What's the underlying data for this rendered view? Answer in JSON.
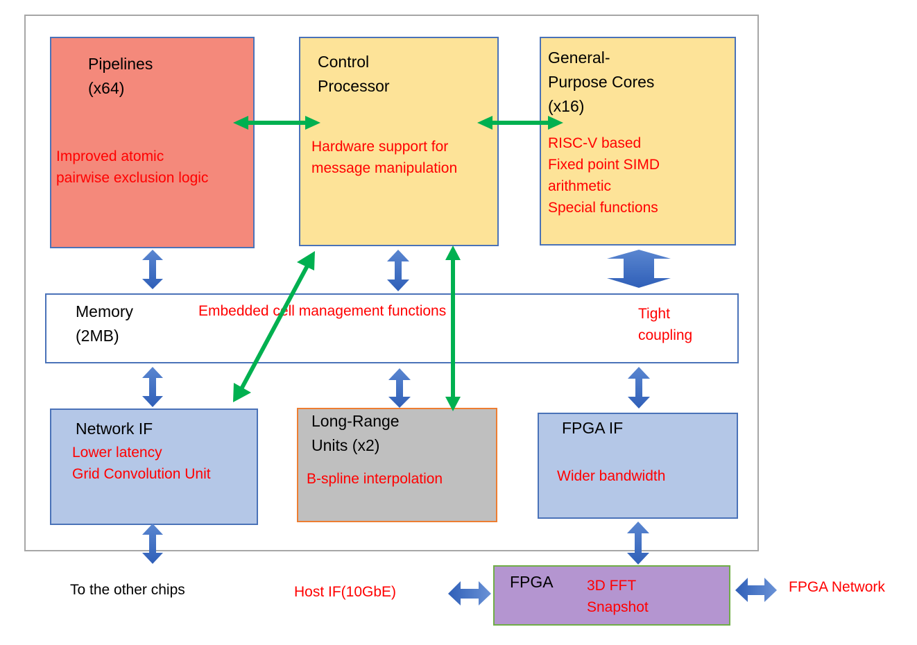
{
  "colors": {
    "note_text": "#ff0000",
    "title_text": "#000000",
    "pipelines_fill": "#f4897b",
    "core_fill": "#fde398",
    "interface_fill": "#b4c7e7",
    "lru_fill": "#bfbfbf",
    "fpga_fill": "#b495d0",
    "block_border": "#4a72b8",
    "blue_arrow": "#4472c4",
    "green_arrow": "#00b050",
    "chip_boundary": "#a6a6a6"
  },
  "blocks": {
    "pipelines": {
      "title": "Pipelines\n(x64)",
      "note": "Improved atomic\npairwise exclusion logic"
    },
    "control_processor": {
      "title": "Control\nProcessor",
      "note": "Hardware support for\nmessage manipulation"
    },
    "general_purpose_cores": {
      "title": "General-\nPurpose Cores\n(x16)",
      "note": "RISC-V based\nFixed point SIMD\narithmetic\nSpecial functions"
    },
    "memory": {
      "title": "Memory\n(2MB)",
      "note": "Embedded cell management functions",
      "note2": "Tight\ncoupling"
    },
    "network_if": {
      "title": "Network IF",
      "note": "Lower latency\nGrid Convolution Unit"
    },
    "long_range_units": {
      "title": "Long-Range\nUnits (x2)",
      "note": "B-spline interpolation"
    },
    "fpga_if": {
      "title": "FPGA IF",
      "note": "Wider bandwidth"
    },
    "fpga": {
      "title": "FPGA",
      "note": "3D FFT\nSnapshot"
    }
  },
  "external_labels": {
    "other_chips": "To the other chips",
    "host_if": "Host IF(10GbE)",
    "fpga_network": "FPGA Network"
  },
  "connections": [
    {
      "from": "Pipelines",
      "to": "Control Processor",
      "style": "green"
    },
    {
      "from": "Control Processor",
      "to": "General-Purpose Cores",
      "style": "green"
    },
    {
      "from": "Pipelines",
      "to": "Memory",
      "style": "blue"
    },
    {
      "from": "Control Processor",
      "to": "Memory",
      "style": "blue"
    },
    {
      "from": "General-Purpose Cores",
      "to": "Memory",
      "style": "blue-wide"
    },
    {
      "from": "Control Processor",
      "to": "Network IF",
      "style": "green"
    },
    {
      "from": "Control Processor",
      "to": "Long-Range Units",
      "style": "green"
    },
    {
      "from": "Memory",
      "to": "Network IF",
      "style": "blue"
    },
    {
      "from": "Memory",
      "to": "Long-Range Units",
      "style": "blue"
    },
    {
      "from": "Memory",
      "to": "FPGA IF",
      "style": "blue"
    },
    {
      "from": "Network IF",
      "to": "To the other chips",
      "style": "blue"
    },
    {
      "from": "FPGA IF",
      "to": "FPGA",
      "style": "blue"
    },
    {
      "from": "Host IF(10GbE)",
      "to": "FPGA",
      "style": "blue"
    },
    {
      "from": "FPGA",
      "to": "FPGA Network",
      "style": "blue"
    }
  ]
}
